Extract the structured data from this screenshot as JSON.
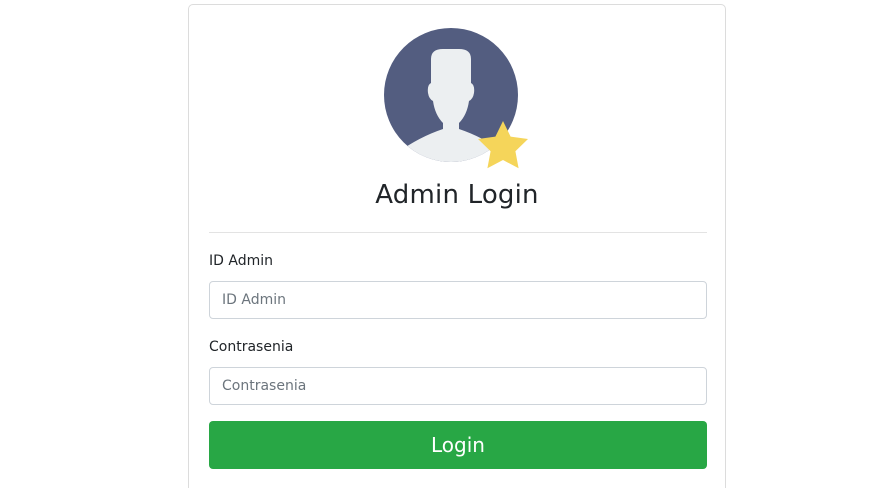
{
  "title": "Admin Login",
  "form": {
    "id_label": "ID Admin",
    "id_placeholder": "ID Admin",
    "id_value": "",
    "password_label": "Contrasenia",
    "password_placeholder": "Contrasenia",
    "password_value": "",
    "submit_label": "Login"
  },
  "icons": {
    "avatar": "admin-avatar-icon",
    "badge": "star-icon"
  },
  "colors": {
    "avatar_circle": "#535d80",
    "avatar_figure": "#eceff1",
    "star": "#f5d55a",
    "login_button": "#28a745",
    "card_border": "#dcdcdc"
  }
}
